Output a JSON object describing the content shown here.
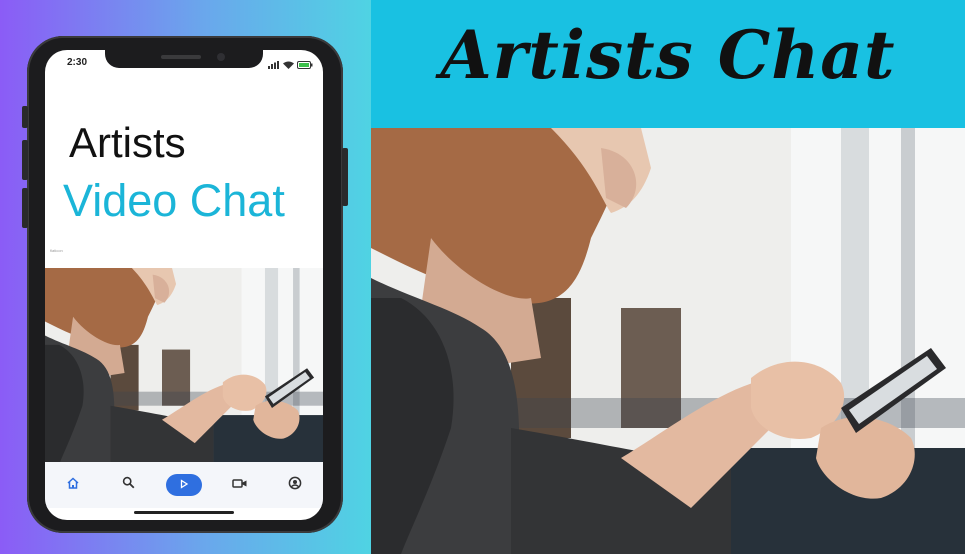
{
  "banner": {
    "title": "Artists Chat"
  },
  "phone": {
    "status": {
      "time": "2:30"
    },
    "app": {
      "title_line1": "Artists",
      "title_line2": "Video Chat",
      "caption": "flaticon"
    },
    "nav": {
      "items": [
        "home-icon",
        "search-icon",
        "play-icon",
        "video-camera-icon",
        "profile-icon"
      ],
      "active": "play-icon"
    }
  },
  "colors": {
    "banner_bg": "#19c1e2",
    "title_accent": "#1bb5d8",
    "nav_active": "#2f6fe0",
    "gradient_start": "#8b5cf6",
    "gradient_end": "#4fd3e3"
  }
}
